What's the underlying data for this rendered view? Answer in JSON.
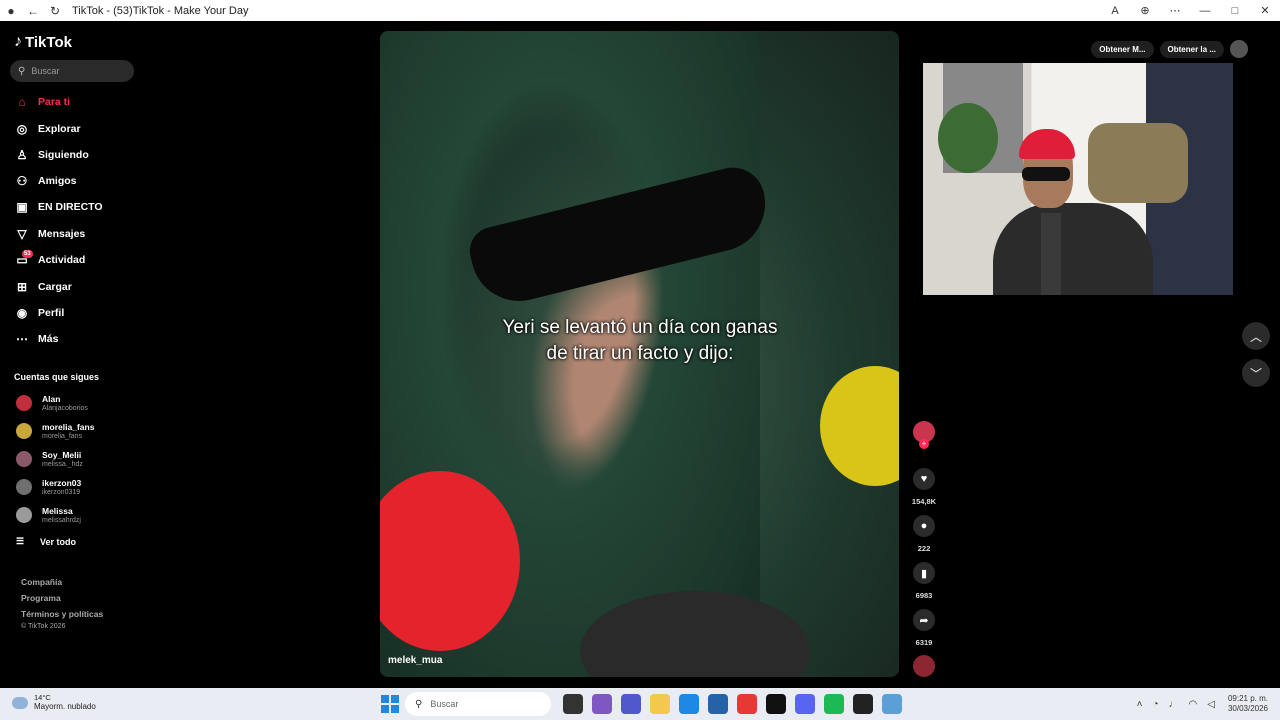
{
  "browser": {
    "title": "TikTok - (53)TikTok - Make Your Day"
  },
  "sidebar": {
    "logo": "TikTok",
    "search_placeholder": "Buscar",
    "nav": [
      {
        "label": "Para ti",
        "icon": "home-icon",
        "active": true
      },
      {
        "label": "Explorar",
        "icon": "compass-icon"
      },
      {
        "label": "Siguiendo",
        "icon": "following-icon"
      },
      {
        "label": "Amigos",
        "icon": "friends-icon"
      },
      {
        "label": "EN DIRECTO",
        "icon": "live-icon"
      },
      {
        "label": "Mensajes",
        "icon": "messages-icon"
      },
      {
        "label": "Actividad",
        "icon": "activity-icon",
        "badge": "53"
      },
      {
        "label": "Cargar",
        "icon": "upload-icon"
      },
      {
        "label": "Perfil",
        "icon": "profile-icon"
      },
      {
        "label": "Más",
        "icon": "more-icon"
      }
    ],
    "following_title": "Cuentas que sigues",
    "accounts": [
      {
        "name": "Alan",
        "handle": "Alanjacoborios",
        "color": "#c0303c"
      },
      {
        "name": "morelia_fans",
        "handle": "morelia_fans",
        "color": "#c9a73a"
      },
      {
        "name": "Soy_Melii",
        "handle": "melissa._hdz",
        "color": "#8a5a6a"
      },
      {
        "name": "ikerzon03",
        "handle": "ikerzon0319",
        "color": "#6f6f6f"
      },
      {
        "name": "Melissa",
        "handle": "melissahrdzj",
        "color": "#9a9a9a"
      }
    ],
    "see_all": "Ver todo",
    "footer": [
      "Compañía",
      "Programa",
      "Términos y políticas"
    ],
    "copyright": "© TikTok 2026"
  },
  "video": {
    "caption": "Yeri se levantó un día con ganas de tirar un facto y dijo:",
    "author": "melek_mua"
  },
  "actions": {
    "likes": "154,8K",
    "comments": "222",
    "saves": "6983",
    "shares": "6319"
  },
  "top_buttons": {
    "get_app_1": "Obtener M...",
    "get_app_2": "Obtener la ..."
  },
  "taskbar": {
    "temp": "14°C",
    "weather": "Mayorm. nublado",
    "search": "Buscar",
    "time": "09:21 p. m.",
    "date": "30/03/2026"
  },
  "colors": {
    "accent": "#fe2c55"
  }
}
